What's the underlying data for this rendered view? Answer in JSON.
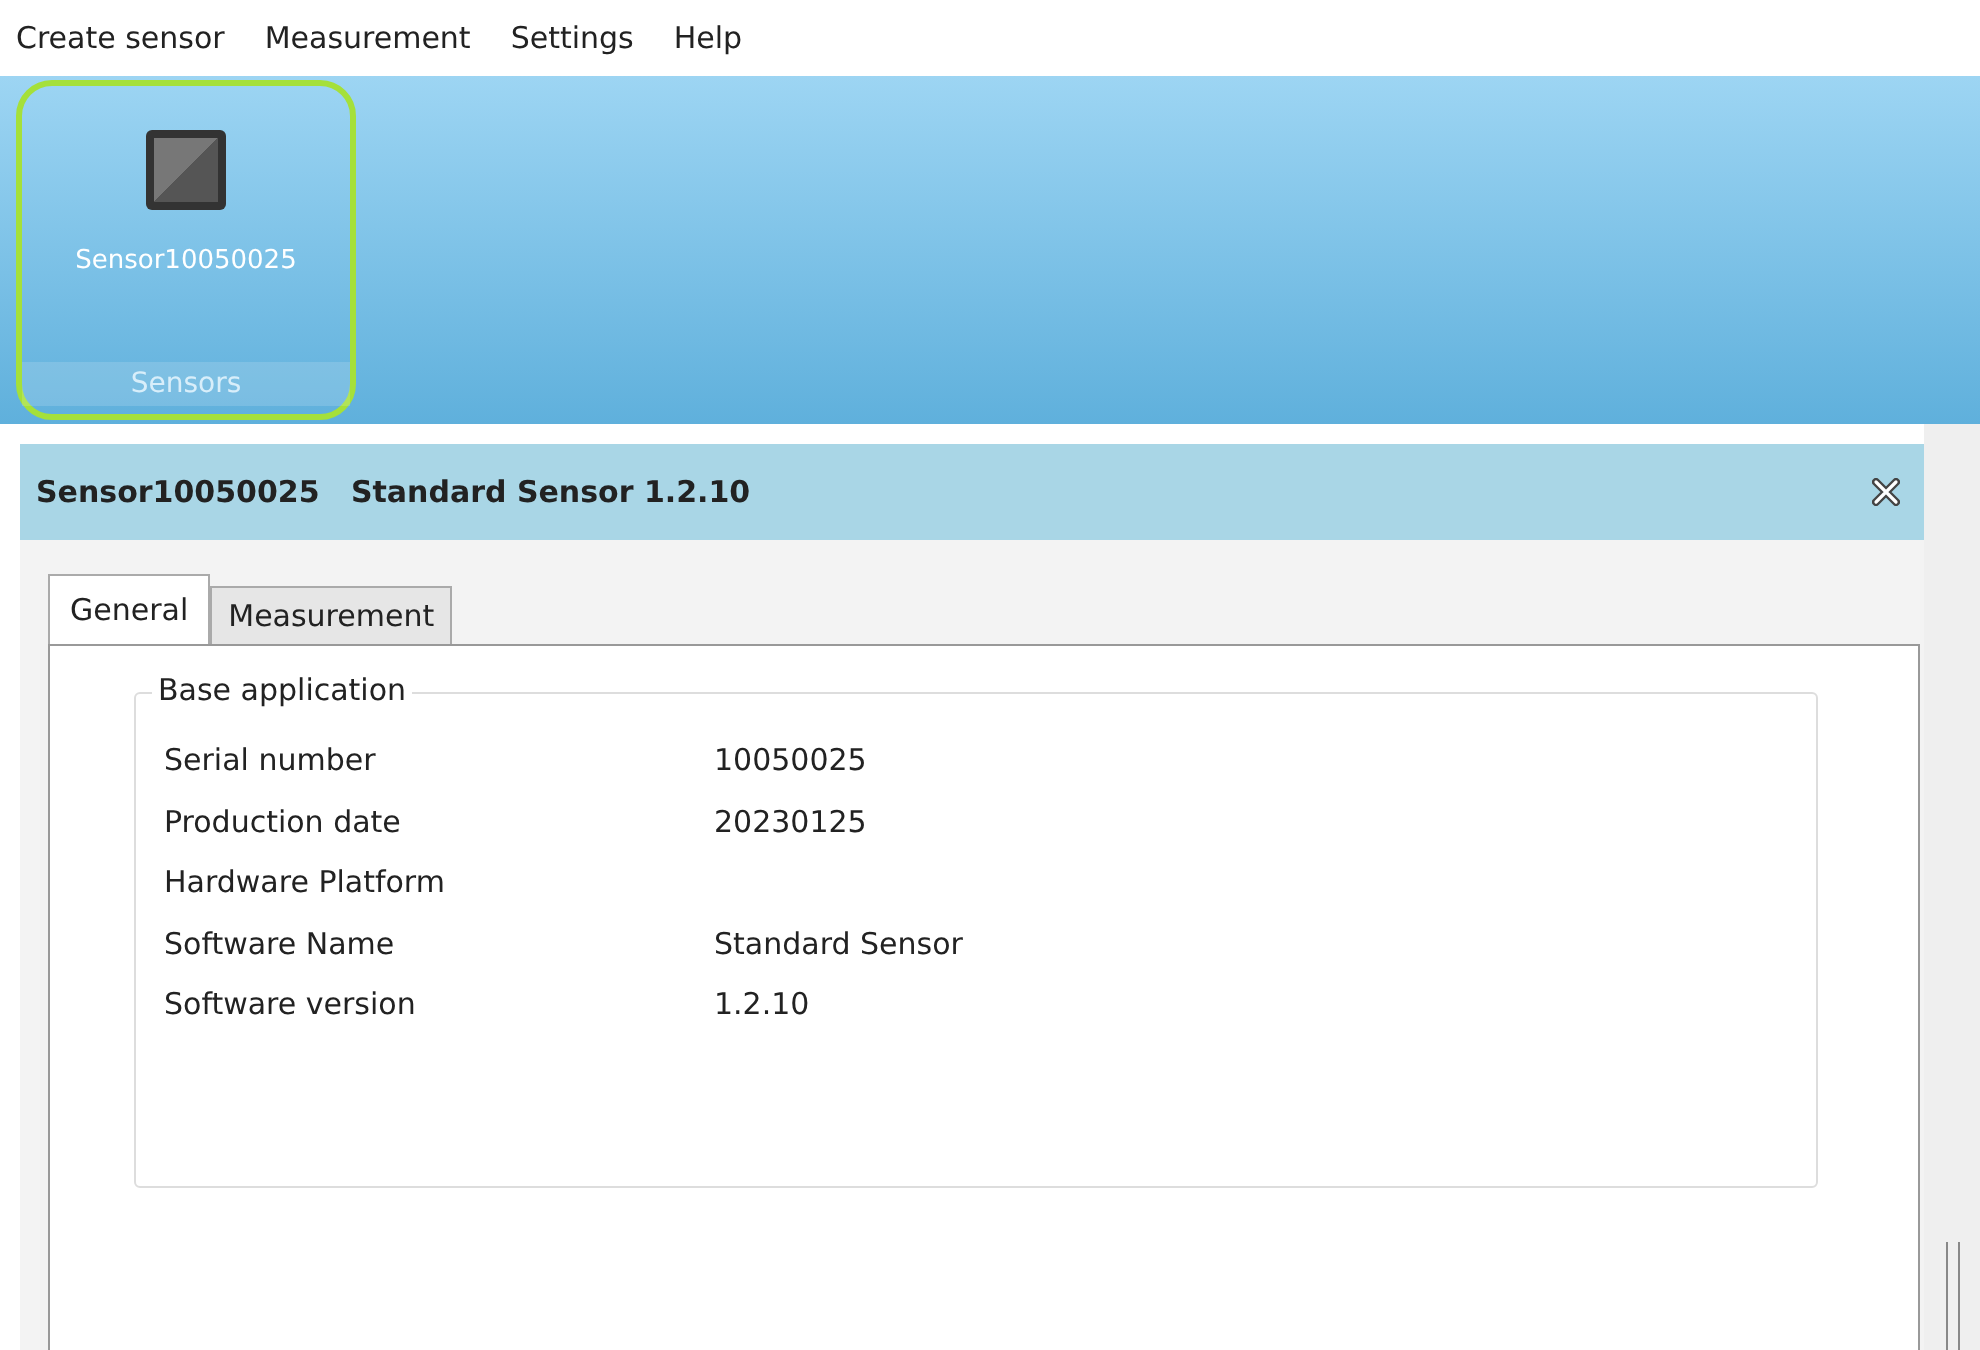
{
  "menu": [
    "Create sensor",
    "Measurement",
    "Settings",
    "Help"
  ],
  "ribbon": {
    "items": [
      {
        "label": "Sensor10050025",
        "selected": true
      }
    ],
    "group_label": "Sensors"
  },
  "panel": {
    "title": "Sensor10050025   Standard Sensor 1.2.10",
    "tabs": [
      {
        "label": "General",
        "selected": true
      },
      {
        "label": "Measurement",
        "selected": false
      }
    ],
    "group": {
      "title": "Base application",
      "rows": [
        {
          "label": "Serial number",
          "value": "10050025"
        },
        {
          "label": "Production date",
          "value": "20230125"
        },
        {
          "label": "Hardware Platform"
        },
        {
          "label": "Software Name",
          "value": "Standard Sensor"
        },
        {
          "label": "Software version",
          "value": "1.2.10"
        }
      ]
    }
  }
}
